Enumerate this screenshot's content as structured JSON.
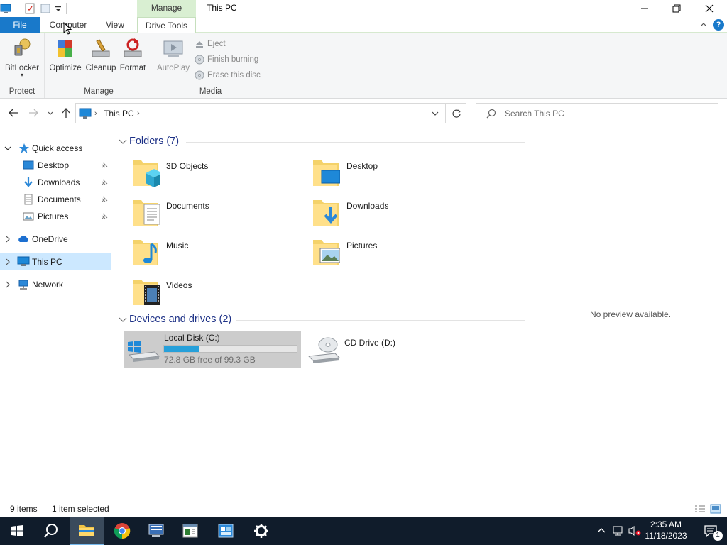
{
  "window": {
    "title": "This PC",
    "context_tab_group": "Manage"
  },
  "ribbon": {
    "tabs": [
      "File",
      "Computer",
      "View",
      "Drive Tools"
    ],
    "active_tab": "Drive Tools",
    "groups": {
      "protect": {
        "label": "Protect",
        "buttons": [
          "BitLocker"
        ]
      },
      "manage": {
        "label": "Manage",
        "buttons": [
          "Optimize",
          "Cleanup",
          "Format"
        ]
      },
      "media": {
        "label": "Media",
        "big_buttons": [
          "AutoPlay"
        ],
        "small_buttons": [
          "Eject",
          "Finish burning",
          "Erase this disc"
        ]
      }
    }
  },
  "address": {
    "path": [
      "This PC"
    ],
    "search_placeholder": "Search This PC"
  },
  "sidebar": {
    "items": [
      {
        "label": "Quick access",
        "icon": "star-icon"
      },
      {
        "label": "Desktop",
        "icon": "desktop-folder-icon",
        "pinned": true
      },
      {
        "label": "Downloads",
        "icon": "download-arrow-icon",
        "pinned": true
      },
      {
        "label": "Documents",
        "icon": "document-icon",
        "pinned": true
      },
      {
        "label": "Pictures",
        "icon": "pictures-icon",
        "pinned": true
      },
      {
        "label": "OneDrive",
        "icon": "cloud-icon"
      },
      {
        "label": "This PC",
        "icon": "computer-icon",
        "selected": true
      },
      {
        "label": "Network",
        "icon": "network-icon"
      }
    ]
  },
  "content": {
    "folders_header": "Folders (7)",
    "folders": [
      "3D Objects",
      "Desktop",
      "Documents",
      "Downloads",
      "Music",
      "Pictures",
      "Videos"
    ],
    "drives_header": "Devices and drives (2)",
    "drives": [
      {
        "name": "Local Disk (C:)",
        "free_text": "72.8 GB free of 99.3 GB",
        "used_fraction": 0.267,
        "selected": true
      },
      {
        "name": "CD Drive (D:)"
      }
    ],
    "preview_text": "No preview available."
  },
  "status": {
    "items_count": "9 items",
    "selected": "1 item selected"
  },
  "taskbar": {
    "time": "2:35 AM",
    "date": "11/18/2023",
    "notification_count": "1"
  },
  "colors": {
    "accent": "#1979ca",
    "selection": "#cce8ff",
    "context_tab": "#d9efd2",
    "taskbar": "#101c2b",
    "section_header": "#1e3287",
    "progress_fill": "#26a0da"
  }
}
